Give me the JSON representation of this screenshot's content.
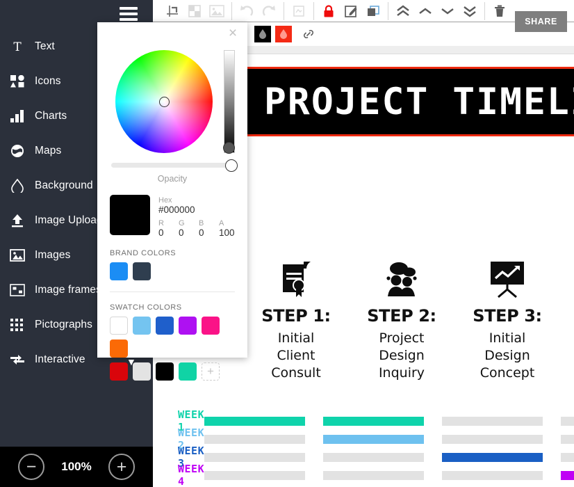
{
  "sidebar": {
    "items": [
      {
        "label": "Text",
        "icon": "text-icon"
      },
      {
        "label": "Icons",
        "icon": "icons-icon"
      },
      {
        "label": "Charts",
        "icon": "charts-icon"
      },
      {
        "label": "Maps",
        "icon": "maps-icon"
      },
      {
        "label": "Background",
        "icon": "background-icon"
      },
      {
        "label": "Image Uploads",
        "icon": "upload-icon"
      },
      {
        "label": "Images",
        "icon": "images-icon"
      },
      {
        "label": "Image frames",
        "icon": "image-frames-icon"
      },
      {
        "label": "Pictographs",
        "icon": "pictographs-icon"
      },
      {
        "label": "Interactive",
        "icon": "interactive-icon"
      }
    ],
    "background": "#2b303b"
  },
  "zoom_control": {
    "minus_label": "−",
    "value": "100%",
    "plus_label": "+"
  },
  "toolbar": {
    "icons": [
      {
        "name": "align-icon",
        "enabled": true
      },
      {
        "name": "mask-icon",
        "enabled": false
      },
      {
        "name": "image-icon",
        "enabled": false
      },
      {
        "name": "undo-icon",
        "enabled": false
      },
      {
        "name": "redo-icon",
        "enabled": false
      },
      {
        "name": "frame-icon",
        "enabled": false
      },
      {
        "name": "lock-icon",
        "enabled": true
      },
      {
        "name": "edit-icon",
        "enabled": true
      },
      {
        "name": "duplicate-icon",
        "enabled": true
      },
      {
        "name": "bring-to-front-icon",
        "enabled": true
      },
      {
        "name": "bring-forward-icon",
        "enabled": true
      },
      {
        "name": "send-backward-icon",
        "enabled": true
      },
      {
        "name": "send-to-back-icon",
        "enabled": true
      },
      {
        "name": "delete-icon",
        "enabled": true
      }
    ],
    "fill_swatch": "#000000",
    "stroke_swatch": "#f42a15",
    "link_icon": "link-icon",
    "share_label": "SHARE"
  },
  "canvas": {
    "banner": {
      "title": "PROJECT TIMELINE",
      "background": "#000000",
      "border_color": "#ee2a10",
      "text_color": "#ffffff"
    },
    "steps": [
      {
        "heading": "STEP 1:",
        "body": "Initial\nClient\nConsult",
        "icon": "certificate-icon"
      },
      {
        "heading": "STEP 2:",
        "body": "Project\nDesign\nInquiry",
        "icon": "discussion-icon"
      },
      {
        "heading": "STEP 3:",
        "body": "Initial\nDesign\nConcept",
        "icon": "presentation-icon"
      }
    ],
    "gantt": {
      "empty_color": "#e2e2e2",
      "rows": [
        {
          "label": "WEEK 1",
          "color": "#0fd3ab",
          "bars": [
            true,
            true,
            false,
            false
          ]
        },
        {
          "label": "WEEK 2",
          "color": "#6ec1ef",
          "bars": [
            false,
            true,
            false,
            false
          ]
        },
        {
          "label": "WEEK 3",
          "color": "#1a5fc4",
          "bars": [
            false,
            false,
            true,
            false
          ]
        },
        {
          "label": "WEEK 4",
          "color": "#bf00f5",
          "bars": [
            false,
            false,
            false,
            true
          ]
        }
      ]
    }
  },
  "color_picker": {
    "close_label": "×",
    "opacity_label": "Opacity",
    "hex_label": "Hex",
    "hex_value": "#000000",
    "channels": [
      {
        "label": "R",
        "value": "0"
      },
      {
        "label": "G",
        "value": "0"
      },
      {
        "label": "B",
        "value": "0"
      },
      {
        "label": "A",
        "value": "100"
      }
    ],
    "preview_color": "#000000",
    "brand_title": "BRAND COLORS",
    "brand_colors": [
      "#1b8df4",
      "#2f3e4f"
    ],
    "swatch_title": "SWATCH COLORS",
    "swatch_colors": [
      "#ffffff",
      "#74c4f0",
      "#1f5fcb",
      "#ae11f2",
      "#fa1387",
      "#fb6a06",
      "#d9050b",
      "#e3e3e3",
      "#000000",
      "#10d3a5"
    ],
    "add_swatch_label": "+",
    "chevron_label": "▼"
  }
}
